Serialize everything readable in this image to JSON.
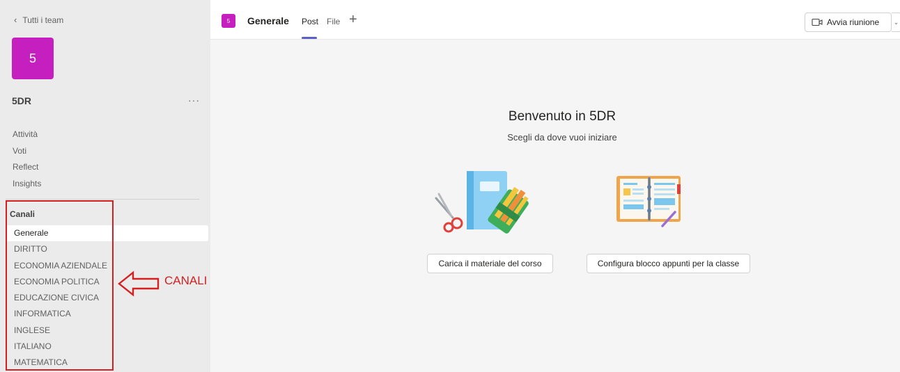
{
  "colors": {
    "team_accent": "#c61fbf",
    "tab_accent": "#5b5fc7",
    "annotation": "#d42020"
  },
  "sidebar": {
    "back_icon": "chevron-left-icon",
    "back_label": "Tutti i team",
    "team_avatar_text": "5",
    "team_name": "5DR",
    "more_label": "···",
    "nav_items": [
      {
        "label": "Attività"
      },
      {
        "label": "Voti"
      },
      {
        "label": "Reflect"
      },
      {
        "label": "Insights"
      }
    ],
    "channels_title": "Canali",
    "channels": [
      {
        "label": "Generale"
      },
      {
        "label": "DIRITTO"
      },
      {
        "label": "ECONOMIA AZIENDALE"
      },
      {
        "label": "ECONOMIA POLITICA"
      },
      {
        "label": "EDUCAZIONE CIVICA"
      },
      {
        "label": "INFORMATICA"
      },
      {
        "label": "INGLESE"
      },
      {
        "label": "ITALIANO"
      },
      {
        "label": "MATEMATICA"
      }
    ]
  },
  "annotation": {
    "label": "CANALI",
    "arrow_icon": "left-arrow-outline-icon"
  },
  "header": {
    "channel_avatar_text": "5",
    "channel_title": "Generale",
    "tabs": [
      {
        "label": "Post"
      },
      {
        "label": "File"
      }
    ],
    "add_tab_label": "+",
    "meet_icon": "video-camera-icon",
    "meet_label": "Avvia riunione",
    "meet_dropdown_icon": "chevron-down-icon"
  },
  "main": {
    "welcome_title": "Benvenuto in 5DR",
    "welcome_subtitle": "Scegli da dove vuoi iniziare",
    "illustration_a": "notebook-scissors-pencils-illustration",
    "illustration_b": "open-notebook-illustration",
    "button_upload": "Carica il materiale del corso",
    "button_notebook": "Configura blocco appunti per la classe"
  }
}
